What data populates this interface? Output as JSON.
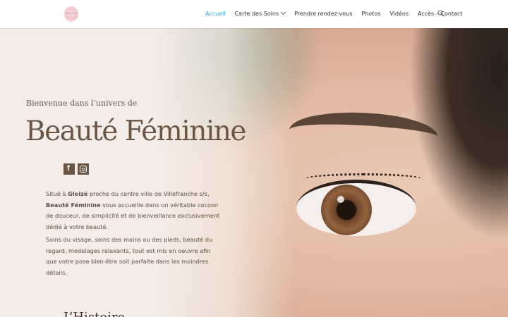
{
  "header": {
    "logo_text": "BEAUTÉ",
    "nav": [
      {
        "label": "Accueil",
        "active": true
      },
      {
        "label": "Carte des Soins",
        "has_dropdown": true
      },
      {
        "label": "Prendre rendez-vous"
      },
      {
        "label": "Photos"
      },
      {
        "label": "Vidéos"
      },
      {
        "label": "Accès – Contact"
      }
    ]
  },
  "hero": {
    "intro": "Bienvenue dans l’univers de",
    "title": "Beauté Féminine",
    "social": [
      "facebook-icon",
      "instagram-icon"
    ],
    "p1": {
      "a": "Situé à ",
      "b": "Gleizé",
      "c": " proche du centre ville de Villefranche s/s,",
      "d": "Beauté Féminine",
      "e": " vous accueille dans un véritable cocoon de douceur, de simplicité et de bienveillance exclusivement dédié à votre beauté."
    },
    "p2": "Soins du visage, soins des mains ou des pieds, beauté du regard, modelages relaxants, tout est mis en oeuvre afin que votre pose bien-être soit parfaite dans les moindres détails.",
    "next_heading": "L’Histoire"
  },
  "colors": {
    "accent": "#2ea3f2",
    "brand_brown": "#6b5646"
  }
}
